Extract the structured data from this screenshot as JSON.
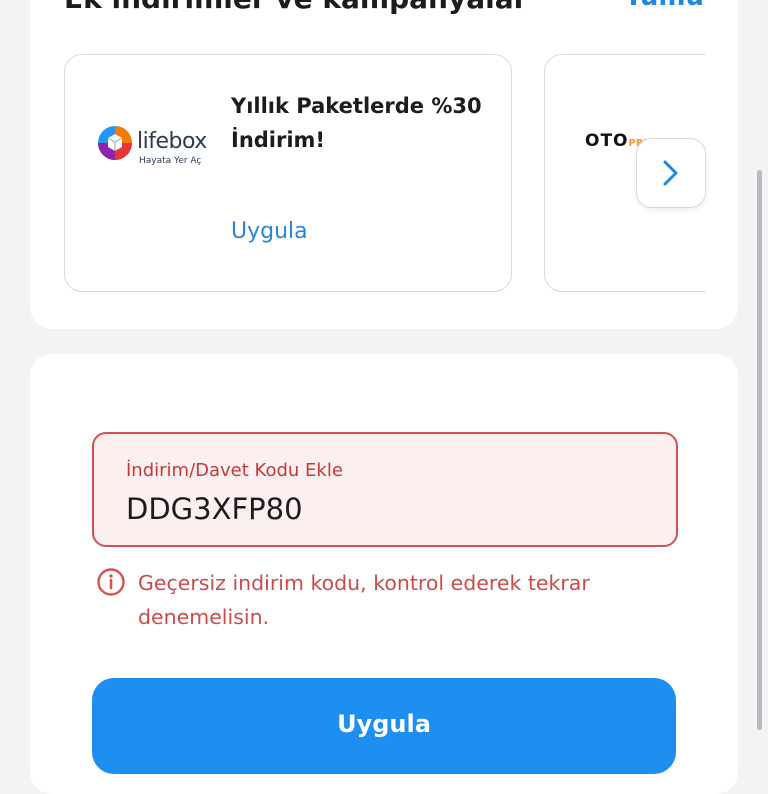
{
  "section": {
    "title": "Ek indirimler ve kampanyalar",
    "see_all_label": "Tümü"
  },
  "promos": [
    {
      "brand": "lifebox",
      "brand_tagline": "Hayata Yer Aç",
      "title": "Yıllık Paketlerde %30 İndirim!",
      "apply_label": "Uygula"
    },
    {
      "brand": "OTO",
      "brand_suffix": "PRE..."
    }
  ],
  "code_field": {
    "label": "İndirim/Davet Kodu Ekle",
    "value": "DDG3XFP80"
  },
  "error": {
    "message": "Geçersiz indirim kodu, kontrol ederek tekrar denemelisin."
  },
  "apply_button": {
    "label": "Uygula"
  },
  "colors": {
    "accent": "#1e8ff0",
    "error": "#d25252",
    "link": "#2b86d6"
  },
  "icons": {
    "next": "chevron-right-icon",
    "error": "info-circle-icon"
  }
}
